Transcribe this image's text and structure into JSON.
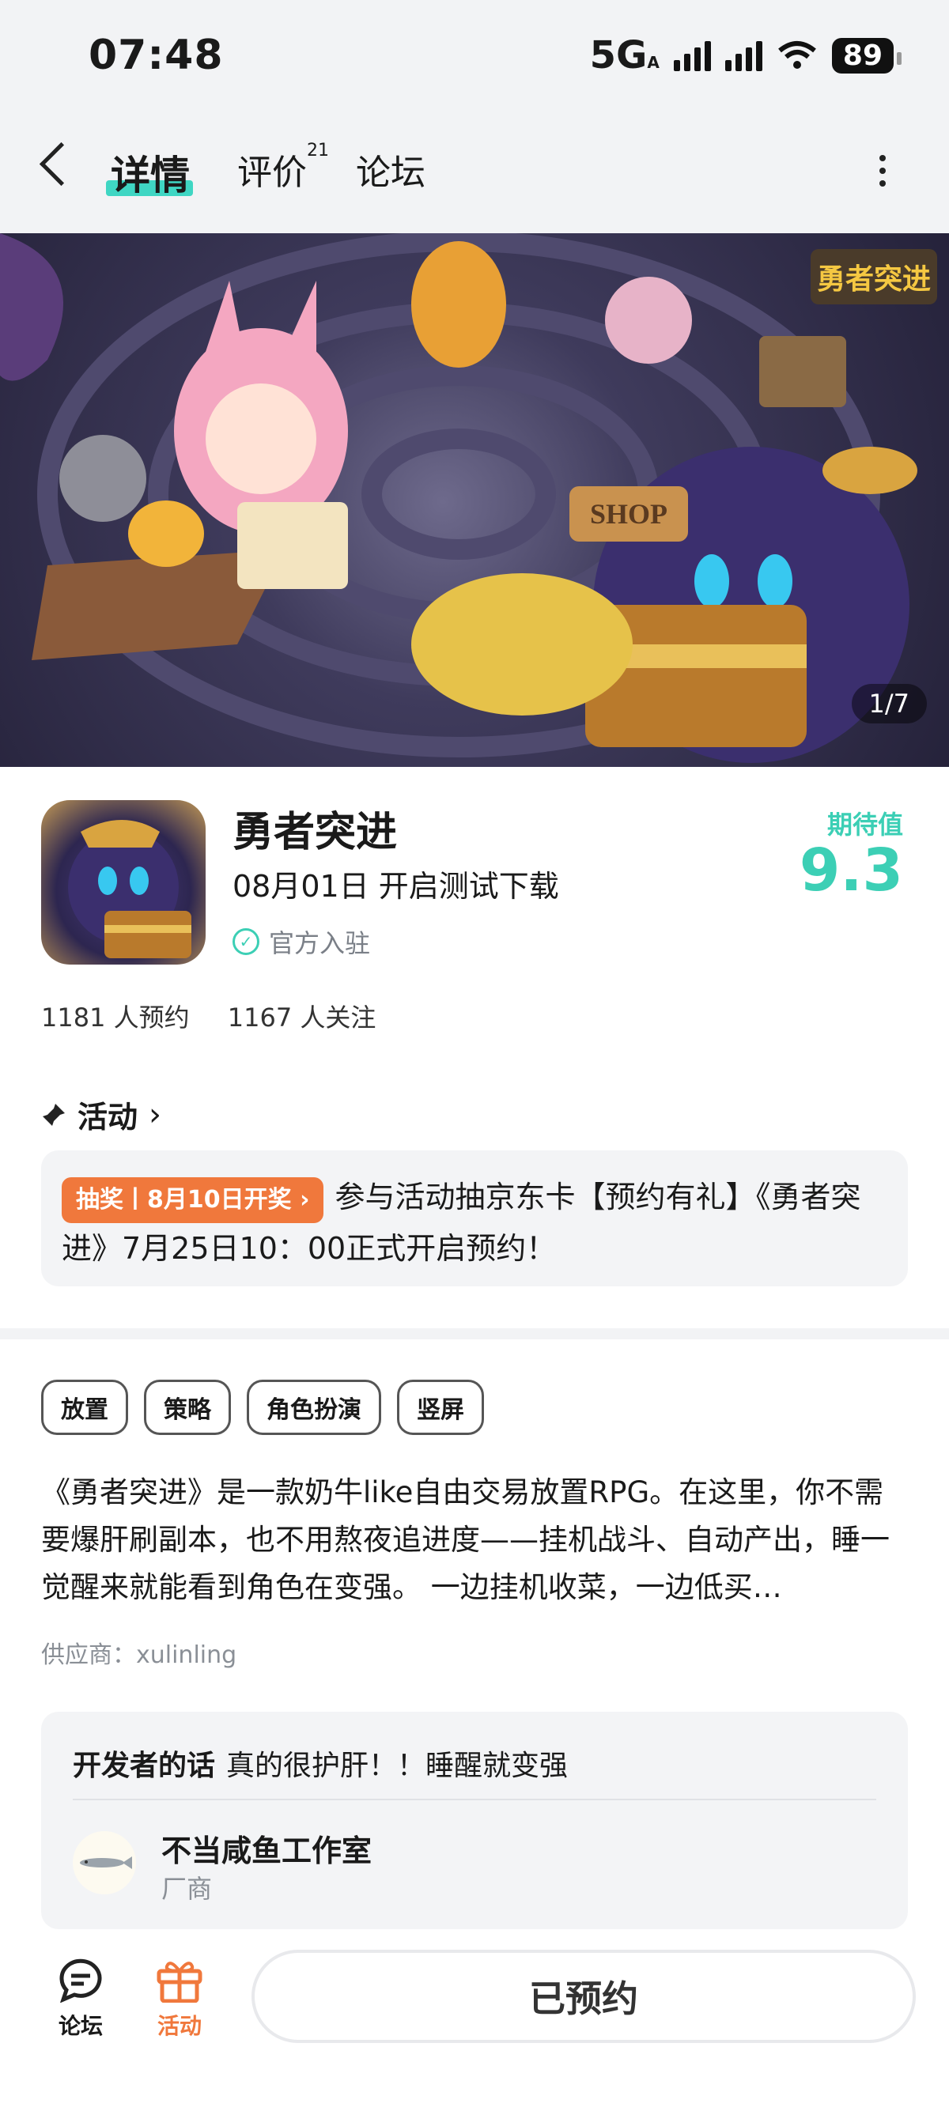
{
  "status_bar": {
    "time": "07:48",
    "network": "5G",
    "network_sub": "A",
    "battery": "89"
  },
  "nav": {
    "tabs": [
      {
        "label": "详情"
      },
      {
        "label": "评价",
        "count": "21"
      },
      {
        "label": "论坛"
      }
    ]
  },
  "banner": {
    "counter": "1/7",
    "logo_text": "勇者突进",
    "sign_text": "SHOP"
  },
  "game": {
    "name": "勇者突进",
    "date": "08月01日 开启测试下载",
    "official": "官方入驻",
    "expect_label": "期待值",
    "expect_value": "9.3",
    "reservations": "1181 人预约",
    "followers": "1167 人关注"
  },
  "activity": {
    "title": "活动",
    "badge": "抽奖丨8月10日开奖",
    "text": "参与活动抽京东卡【预约有礼】《勇者突进》7月25日10：00正式开启预约！"
  },
  "tags": [
    "放置",
    "策略",
    "角色扮演",
    "竖屏"
  ],
  "description": "《勇者突进》是一款奶牛like自由交易放置RPG。在这里，你不需要爆肝刷副本，也不用熬夜追进度——挂机战斗、自动产出，睡一觉醒来就能看到角色在变强。 一边挂机收菜，一边低买…",
  "supplier": "供应商：xulinling",
  "developer": {
    "label": "开发者的话",
    "words": "真的很护肝！！睡醒就变强",
    "name": "不当咸鱼工作室",
    "role": "厂商"
  },
  "bottom": {
    "forum": "论坛",
    "activity": "活动",
    "reserved": "已预约"
  },
  "colors": {
    "accent": "#3fd6c3",
    "orange": "#f0783c"
  }
}
